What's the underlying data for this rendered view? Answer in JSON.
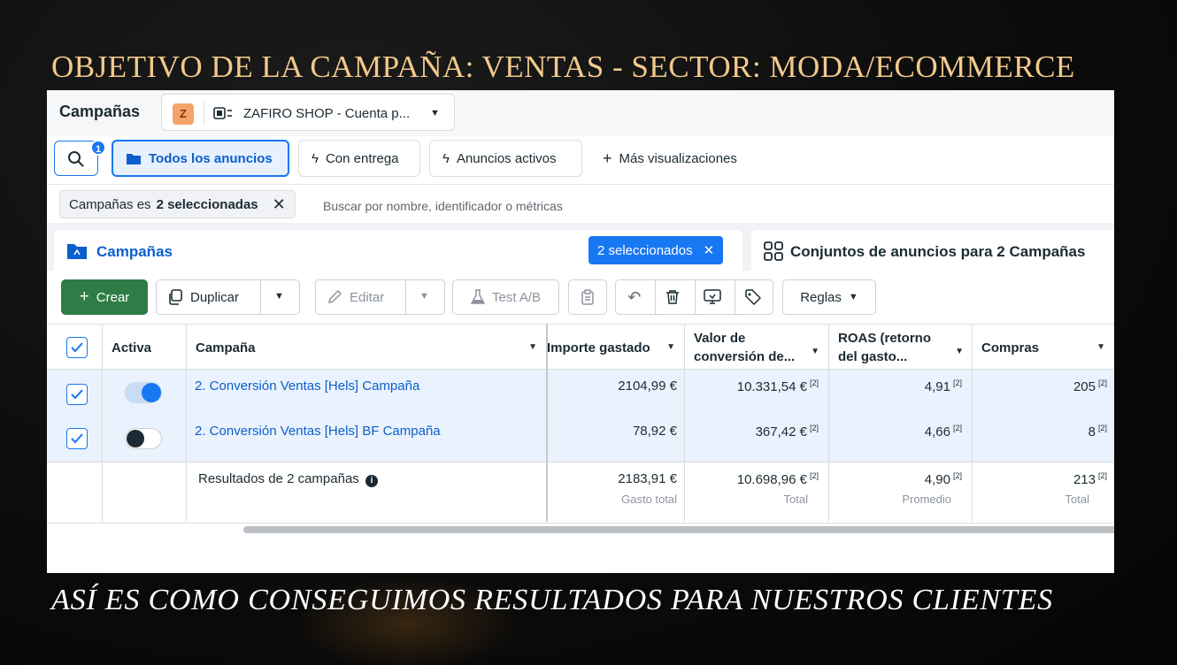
{
  "headline": "OBJETIVO DE LA CAMPAÑA: VENTAS - SECTOR: MODA/ECOMMERCE",
  "footline": "ASÍ ES COMO CONSEGUIMOS RESULTADOS PARA NUESTROS CLIENTES",
  "colors": {
    "accent": "#1877f2",
    "headline": "#f2c98c",
    "create": "#2e7d46",
    "row_selected": "#eaf2fd"
  },
  "header": {
    "title": "Campañas",
    "account": {
      "avatar_letter": "Z",
      "name": "ZAFIRO SHOP - Cuenta p...",
      "icon": "ad-account-icon"
    }
  },
  "views": {
    "search_badge": "1",
    "items": [
      {
        "label": "Todos los anuncios",
        "icon": "folder-icon",
        "active": true
      },
      {
        "label": "Con entrega",
        "icon": "lightning-icon",
        "active": false
      },
      {
        "label": "Anuncios activos",
        "icon": "lightning-icon",
        "active": false
      },
      {
        "label": "Más visualizaciones",
        "icon": "plus-icon",
        "active": false
      }
    ]
  },
  "filter": {
    "chip_prefix": "Campañas es",
    "chip_value": "2 seleccionadas",
    "search_placeholder": "Buscar por nombre, identificador o métricas"
  },
  "tabs": {
    "main_label": "Campañas",
    "selected_pill": "2 seleccionados",
    "side_label": "Conjuntos de anuncios para 2 Campañas"
  },
  "toolbar": {
    "create": "Crear",
    "duplicate": "Duplicar",
    "edit": "Editar",
    "ab_test": "Test A/B",
    "rules": "Reglas"
  },
  "table": {
    "columns": {
      "active": "Activa",
      "campaign": "Campaña",
      "spent": "Importe gastado",
      "conv_value_1": "Valor de",
      "conv_value_2": "conversión de...",
      "roas_1": "ROAS (retorno",
      "roas_2": "del gasto...",
      "purchases": "Compras"
    },
    "rows": [
      {
        "active": true,
        "name": "2. Conversión Ventas [Hels] Campaña",
        "spent": "2104,99 €",
        "conv_value": "10.331,54 €",
        "roas": "4,91",
        "purchases": "205",
        "note": "[2]"
      },
      {
        "active": false,
        "name": "2. Conversión Ventas [Hels] BF Campaña",
        "spent": "78,92 €",
        "conv_value": "367,42 €",
        "roas": "4,66",
        "purchases": "8",
        "note": "[2]"
      }
    ],
    "totals": {
      "label": "Resultados de 2 campañas",
      "spent": "2183,91 €",
      "spent_sub": "Gasto total",
      "conv_value": "10.698,96 €",
      "conv_value_sub": "Total",
      "roas": "4,90",
      "roas_sub": "Promedio",
      "purchases": "213",
      "purchases_sub": "Total",
      "note": "[2]"
    }
  }
}
